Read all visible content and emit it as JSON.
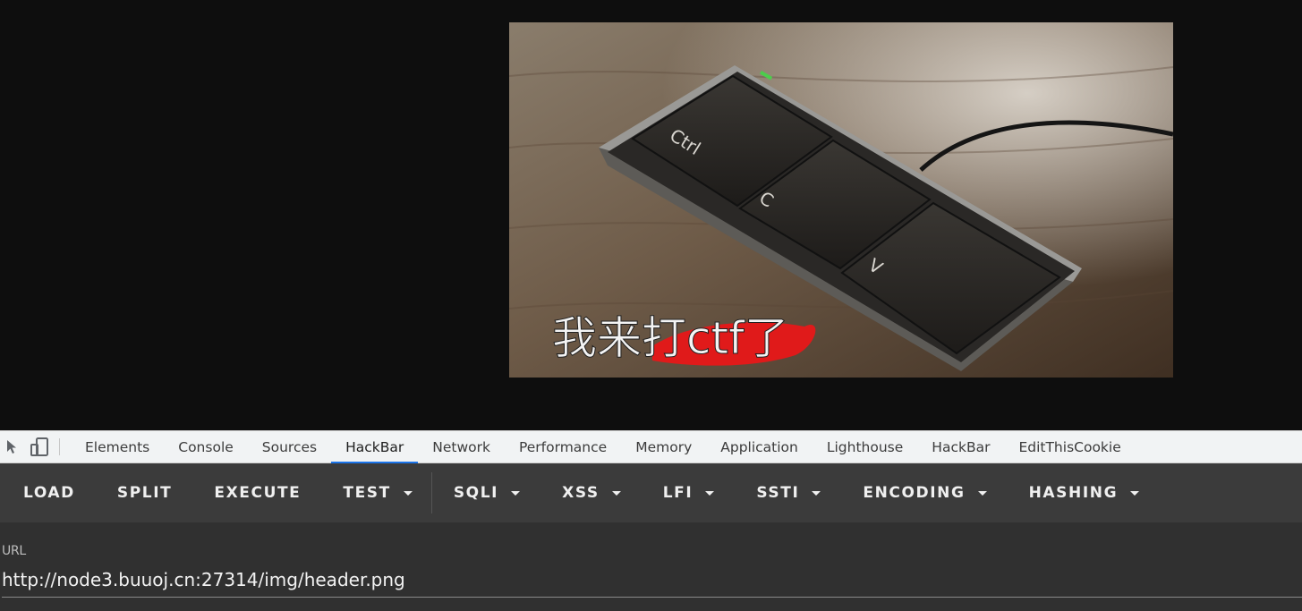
{
  "page": {
    "image": {
      "caption_text": "我来打ctf了",
      "key_labels": [
        "Ctrl",
        "C",
        "V"
      ]
    }
  },
  "devtools": {
    "tool_icons": [
      "inspect-element-icon",
      "device-toolbar-icon"
    ],
    "tabs": [
      {
        "label": "Elements",
        "active": false
      },
      {
        "label": "Console",
        "active": false
      },
      {
        "label": "Sources",
        "active": false
      },
      {
        "label": "HackBar",
        "active": true
      },
      {
        "label": "Network",
        "active": false
      },
      {
        "label": "Performance",
        "active": false
      },
      {
        "label": "Memory",
        "active": false
      },
      {
        "label": "Application",
        "active": false
      },
      {
        "label": "Lighthouse",
        "active": false
      },
      {
        "label": "HackBar",
        "active": false
      },
      {
        "label": "EditThisCookie",
        "active": false
      }
    ],
    "active_tab_color": "#1a73e8"
  },
  "hackbar": {
    "buttons": [
      {
        "label": "LOAD",
        "dropdown": false
      },
      {
        "label": "SPLIT",
        "dropdown": false
      },
      {
        "label": "EXECUTE",
        "dropdown": false
      },
      {
        "label": "TEST",
        "dropdown": true
      },
      {
        "label": "SQLI",
        "dropdown": true
      },
      {
        "label": "XSS",
        "dropdown": true
      },
      {
        "label": "LFI",
        "dropdown": true
      },
      {
        "label": "SSTI",
        "dropdown": true
      },
      {
        "label": "ENCODING",
        "dropdown": true
      },
      {
        "label": "HASHING",
        "dropdown": true
      }
    ],
    "url_label": "URL",
    "url_value": "http://node3.buuoj.cn:27314/img/header.png"
  }
}
